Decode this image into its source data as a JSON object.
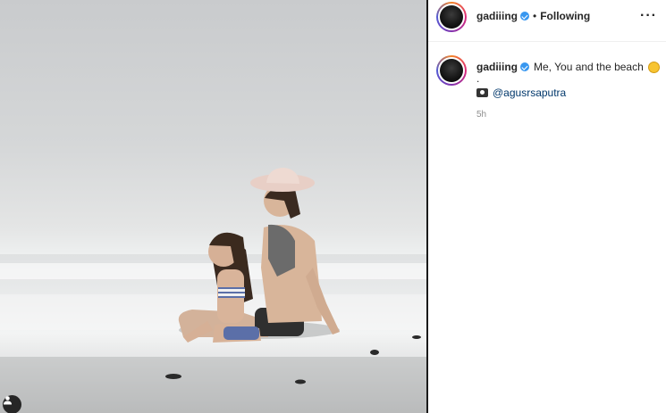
{
  "post": {
    "image_alt": "Father and daughter sitting in the sea on the beach"
  },
  "header": {
    "username": "gadiiing",
    "separator": "•",
    "follow_status": "Following",
    "more_label": "···"
  },
  "caption": {
    "username": "gadiiing",
    "text": "Me, You and the beach",
    "line2": ".",
    "mention": "@agusrsaputra",
    "time": "5h"
  },
  "colors": {
    "verified": "#3897f0",
    "mention": "#00376b",
    "muted": "#8e8e8e"
  },
  "icons": {
    "verified": "verified-badge-icon",
    "more": "more-options-icon",
    "camera": "camera-icon",
    "emoji": "hugging-face-emoji-icon",
    "tag": "user-tag-icon"
  }
}
